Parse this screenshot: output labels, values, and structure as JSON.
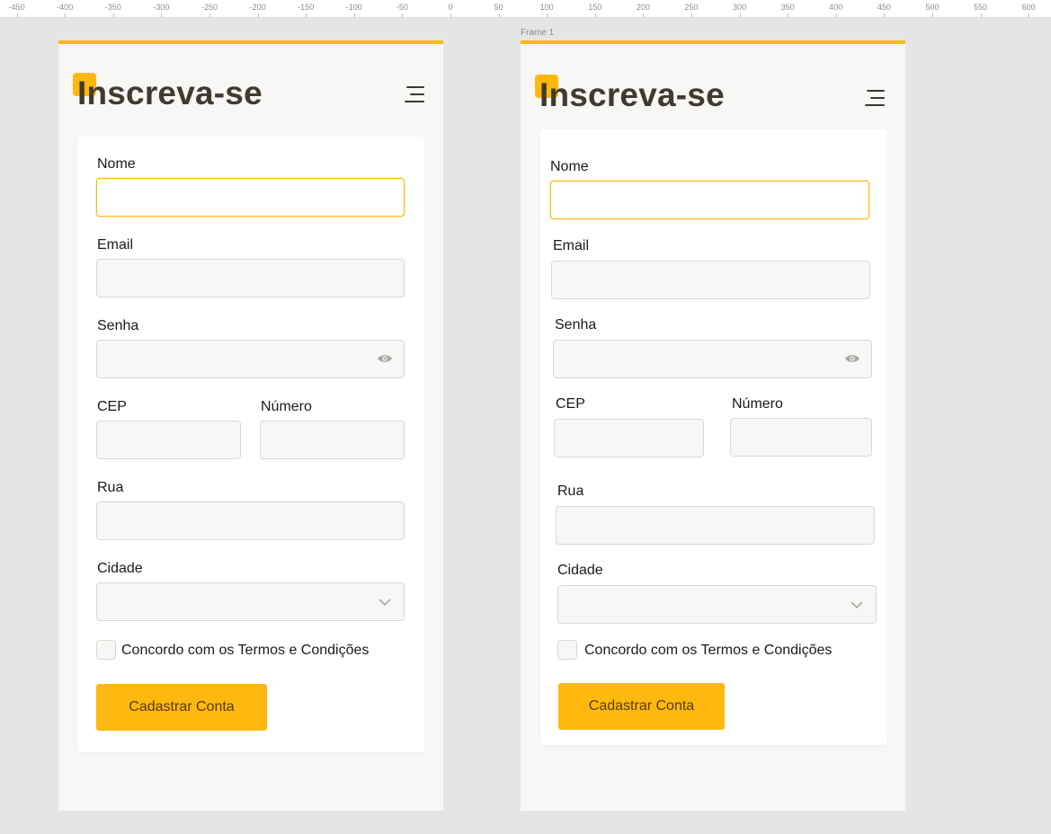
{
  "ruler": {
    "ticks": [
      "-450",
      "-400",
      "-350",
      "-300",
      "-250",
      "-200",
      "-150",
      "-100",
      "-50",
      "0",
      "50",
      "100",
      "150",
      "200",
      "250",
      "300",
      "350",
      "400",
      "450",
      "500",
      "550",
      "600"
    ]
  },
  "frame_label": "Frame 1",
  "form": {
    "title": "Inscreva-se",
    "fields": {
      "nome": "Nome",
      "email": "Email",
      "senha": "Senha",
      "cep": "CEP",
      "numero": "Número",
      "rua": "Rua",
      "cidade": "Cidade"
    },
    "checkbox_label": "Concordo com os Termos e Condições",
    "submit_label": "Cadastrar Conta"
  },
  "icons": {
    "menu": "menu-icon",
    "password_toggle": "eye-icon",
    "dropdown": "chevron-down-icon"
  },
  "colors": {
    "accent": "#ffb80f",
    "frame_background": "#f8f7f5",
    "title_text": "#403b2f",
    "button_text": "#5a3b0a"
  }
}
